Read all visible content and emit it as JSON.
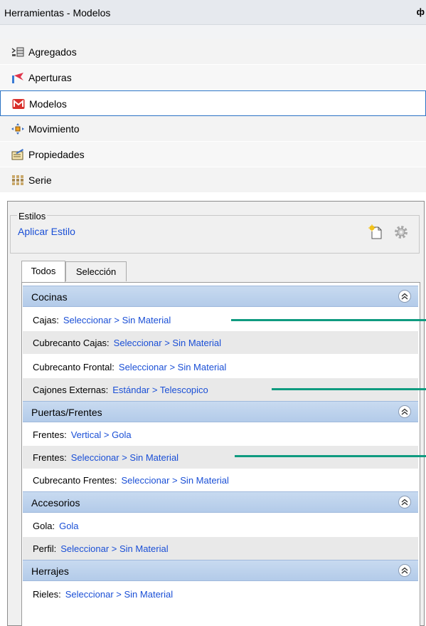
{
  "window": {
    "title": "Herramientas - Modelos",
    "pin_glyph": "ф"
  },
  "nav": [
    {
      "label": "Agregados",
      "icon": "aggregate-icon"
    },
    {
      "label": "Aperturas",
      "icon": "opening-flag-icon"
    },
    {
      "label": "Modelos",
      "icon": "models-icon",
      "selected": true
    },
    {
      "label": "Movimiento",
      "icon": "move-arrows-icon"
    },
    {
      "label": "Propiedades",
      "icon": "properties-icon"
    },
    {
      "label": "Serie",
      "icon": "series-grid-icon"
    }
  ],
  "styles": {
    "legend": "Estilos",
    "apply_label": "Aplicar Estilo",
    "new_icon": "new-style-icon",
    "settings_icon": "gear-icon"
  },
  "tabs": [
    {
      "label": "Todos",
      "active": true
    },
    {
      "label": "Selección",
      "active": false
    }
  ],
  "groups": [
    {
      "title": "Cocinas",
      "rows": [
        {
          "label": "Cajas:",
          "value": "Seleccionar > Sin Material"
        },
        {
          "label": "Cubrecanto Cajas:",
          "value": "Seleccionar > Sin Material"
        },
        {
          "label": "Cubrecanto Frontal:",
          "value": "Seleccionar > Sin Material"
        },
        {
          "label": "Cajones Externas:",
          "value": "Estándar > Telescopico"
        }
      ]
    },
    {
      "title": "Puertas/Frentes",
      "rows": [
        {
          "label": "Frentes:",
          "value": "Vertical > Gola"
        },
        {
          "label": "Frentes:",
          "value": "Seleccionar > Sin Material"
        },
        {
          "label": "Cubrecanto Frentes:",
          "value": "Seleccionar > Sin Material"
        }
      ]
    },
    {
      "title": "Accesorios",
      "rows": [
        {
          "label": "Gola:",
          "value": "Gola"
        },
        {
          "label": "Perfil:",
          "value": "Seleccionar > Sin Material"
        }
      ]
    },
    {
      "title": "Herrajes",
      "rows": [
        {
          "label": "Rieles:",
          "value": "Seleccionar > Sin Material"
        }
      ]
    }
  ],
  "colors": {
    "accent_link": "#1a4fd6",
    "pointer_line": "#0f9b80",
    "group_header": "#bcd2ee",
    "selected_border": "#2b73c4"
  }
}
